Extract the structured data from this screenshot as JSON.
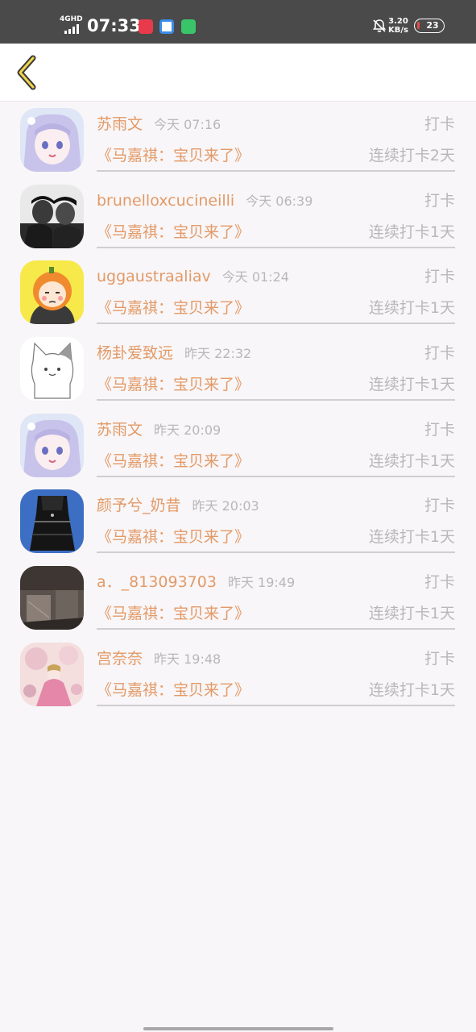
{
  "status_bar": {
    "network": "4GHD",
    "time": "07:33",
    "speed_value": "3.20",
    "speed_unit": "KB/s",
    "battery": "23",
    "app_icons": [
      "app-icon-red",
      "app-icon-blue",
      "app-icon-green"
    ]
  },
  "header": {
    "back_icon": "chevron-left-icon"
  },
  "colors": {
    "accent": "#e39a67",
    "muted": "#b8b8b8",
    "background": "#f8f6f8"
  },
  "records": [
    {
      "name": "苏雨文",
      "time": "今天 07:16",
      "action": "打卡",
      "book": "《马嘉祺：宝贝来了》",
      "streak": "连续打卡2天"
    },
    {
      "name": "brunelloxcucineilli",
      "time": "今天 06:39",
      "action": "打卡",
      "book": "《马嘉祺：宝贝来了》",
      "streak": "连续打卡1天"
    },
    {
      "name": "uggaustraaliav",
      "time": "今天 01:24",
      "action": "打卡",
      "book": "《马嘉祺：宝贝来了》",
      "streak": "连续打卡1天"
    },
    {
      "name": "杨卦爱致远",
      "time": "昨天 22:32",
      "action": "打卡",
      "book": "《马嘉祺：宝贝来了》",
      "streak": "连续打卡1天"
    },
    {
      "name": "苏雨文",
      "time": "昨天 20:09",
      "action": "打卡",
      "book": "《马嘉祺：宝贝来了》",
      "streak": "连续打卡1天"
    },
    {
      "name": "颜予兮_奶昔",
      "time": "昨天 20:03",
      "action": "打卡",
      "book": "《马嘉祺：宝贝来了》",
      "streak": "连续打卡1天"
    },
    {
      "name": "a．_813093703",
      "time": "昨天 19:49",
      "action": "打卡",
      "book": "《马嘉祺：宝贝来了》",
      "streak": "连续打卡1天"
    },
    {
      "name": "宫奈奈",
      "time": "昨天 19:48",
      "action": "打卡",
      "book": "《马嘉祺：宝贝来了》",
      "streak": "连续打卡1天"
    }
  ]
}
